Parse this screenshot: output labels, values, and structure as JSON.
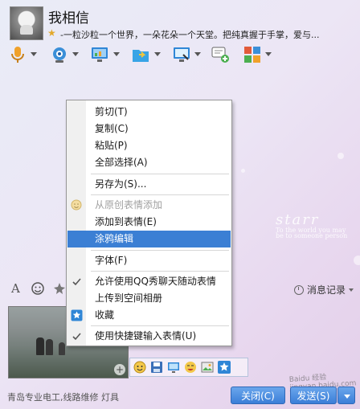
{
  "contact": {
    "name": "我相信",
    "signature": "-一粒沙粒一个世界，一朵花朵一个天堂。把纯真握于手掌，爱与..."
  },
  "toolbar": {
    "items": [
      {
        "name": "voice-icon",
        "color": "#f0a12a"
      },
      {
        "name": "video-icon",
        "color": "#3a8fd8"
      },
      {
        "name": "remote-desktop-icon",
        "color": "#2f86d6"
      },
      {
        "name": "send-file-icon",
        "color": "#2f86d6"
      },
      {
        "name": "screen-share-icon",
        "color": "#2f86d6"
      },
      {
        "name": "create-group-icon",
        "color": "#4caf50"
      },
      {
        "name": "apps-grid-icon",
        "color": "#e25b3a"
      }
    ]
  },
  "background_deco": {
    "big_text": "starr",
    "small_line1": "To the world you may",
    "small_line2": "be to someone person"
  },
  "format_bar": {
    "message_record": "消息记录",
    "font_icon": "font-icon",
    "emoji_icon": "emoji-icon",
    "magic_icon": "magic-emoji-icon"
  },
  "context_menu": {
    "items": [
      {
        "label": "剪切(T)",
        "state": "normal"
      },
      {
        "label": "复制(C)",
        "state": "normal"
      },
      {
        "label": "粘贴(P)",
        "state": "normal"
      },
      {
        "label": "全部选择(A)",
        "state": "normal"
      },
      {
        "label": "另存为(S)...",
        "state": "normal"
      },
      {
        "label": "从原创表情添加",
        "state": "disabled",
        "icon": "add-emoticon-icon"
      },
      {
        "label": "添加到表情(E)",
        "state": "normal"
      },
      {
        "label": "涂鸦编辑",
        "state": "highlighted"
      },
      {
        "label": "字体(F)",
        "state": "normal"
      },
      {
        "label": "允许使用QQ秀聊天随动表情",
        "state": "checked"
      },
      {
        "label": "上传到空间相册",
        "state": "normal"
      },
      {
        "label": "收藏",
        "state": "normal",
        "icon": "favorite-star-icon"
      },
      {
        "label": "使用快捷键输入表情(U)",
        "state": "checked"
      }
    ]
  },
  "input": {
    "image_tools": [
      "emoticon-add-icon",
      "save-image-icon",
      "screen-icon",
      "emoji-face-icon",
      "image-edit-icon",
      "favorite-icon"
    ]
  },
  "footer": {
    "ad_text": "青岛专业电工,线路维修 灯具",
    "close_button": "关闭(C)",
    "send_button": "发送(S)",
    "watermark": "Baidu 经验 jingyan.baidu.com"
  },
  "colors": {
    "highlight": "#3b7fd4",
    "button": "#3b7ed8",
    "star": "#e3a92b"
  }
}
